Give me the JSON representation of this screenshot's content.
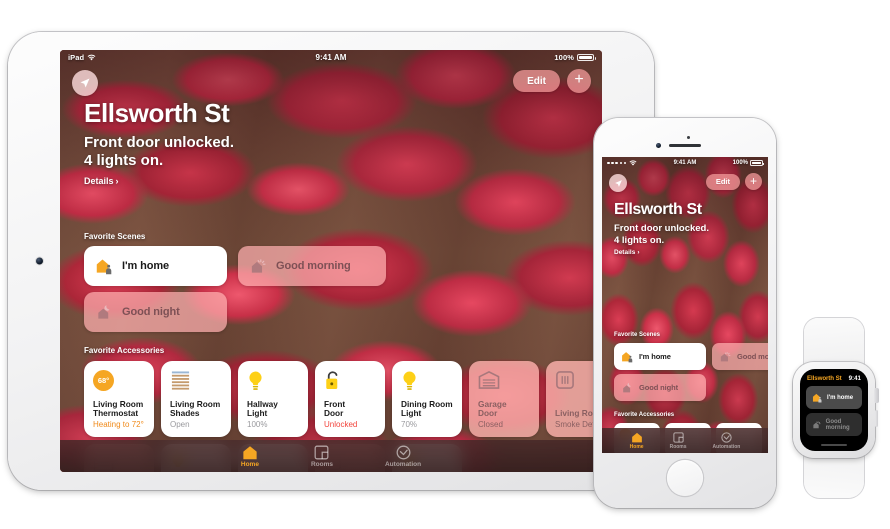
{
  "ipad": {
    "status": {
      "carrier": "iPad",
      "wifi_icon": "wifi-icon",
      "time": "9:41 AM",
      "battery": "100%"
    },
    "header": {
      "location_icon": "location-arrow-icon",
      "edit_label": "Edit",
      "add_label": "+",
      "title": "Ellsworth St",
      "subtitle_line1": "Front door unlocked.",
      "subtitle_line2": "4 lights on.",
      "details_label": "Details",
      "details_chevron": "›"
    },
    "scenes_section_label": "Favorite Scenes",
    "scenes": [
      {
        "label": "I'm home",
        "icon": "home-person-icon",
        "state": "active"
      },
      {
        "label": "Good morning",
        "icon": "home-sun-icon",
        "state": "dim"
      },
      {
        "label": "Good night",
        "icon": "home-moon-icon",
        "state": "dim"
      }
    ],
    "accessories_section_label": "Favorite Accessories",
    "accessories": [
      {
        "name": "Living Room\nThermostat",
        "status": "Heating to 72°",
        "icon": "thermostat-icon",
        "badge": "68°",
        "state": "on",
        "status_style": "warm"
      },
      {
        "name": "Living Room\nShades",
        "status": "Open",
        "icon": "blinds-icon",
        "state": "on",
        "status_style": "muted"
      },
      {
        "name": "Hallway\nLight",
        "status": "100%",
        "icon": "bulb-icon",
        "state": "on",
        "status_style": "muted"
      },
      {
        "name": "Front\nDoor",
        "status": "Unlocked",
        "icon": "unlocked-padlock-icon",
        "state": "on",
        "status_style": "alert"
      },
      {
        "name": "Dining Room\nLight",
        "status": "70%",
        "icon": "bulb-icon",
        "state": "on",
        "status_style": "muted"
      },
      {
        "name": "Garage\nDoor",
        "status": "Closed",
        "icon": "garage-door-icon",
        "state": "off",
        "status_style": "muted"
      },
      {
        "name": "Living Roo",
        "status": "Smoke Det",
        "icon": "smoke-detector-icon",
        "state": "off",
        "status_style": "muted"
      }
    ],
    "tabs": [
      {
        "label": "Home",
        "icon": "home-icon",
        "selected": true
      },
      {
        "label": "Rooms",
        "icon": "rooms-icon",
        "selected": false
      },
      {
        "label": "Automation",
        "icon": "automation-icon",
        "selected": false
      }
    ]
  },
  "iphone": {
    "status": {
      "signal_icon": "signal-dots-icon",
      "wifi_icon": "wifi-icon",
      "time": "9:41 AM",
      "battery": "100%"
    },
    "header": {
      "location_icon": "location-arrow-icon",
      "edit_label": "Edit",
      "add_label": "+",
      "title": "Ellsworth St",
      "subtitle_line1": "Front door unlocked.",
      "subtitle_line2": "4 lights on.",
      "details_label": "Details",
      "details_chevron": "›"
    },
    "scenes_section_label": "Favorite Scenes",
    "scenes": [
      {
        "label": "I'm home",
        "icon": "home-person-icon",
        "state": "active"
      },
      {
        "label": "Good mo",
        "icon": "home-sun-icon",
        "state": "dim"
      },
      {
        "label": "Good night",
        "icon": "home-moon-icon",
        "state": "dim"
      }
    ],
    "accessories_section_label": "Favorite Accessories",
    "tabs": [
      {
        "label": "Home",
        "icon": "home-icon",
        "selected": true
      },
      {
        "label": "Rooms",
        "icon": "rooms-icon",
        "selected": false
      },
      {
        "label": "Automation",
        "icon": "automation-icon",
        "selected": false
      }
    ]
  },
  "watch": {
    "title": "Ellsworth St",
    "time": "9:41",
    "scenes": [
      {
        "label": "I'm home",
        "icon": "home-person-icon",
        "state": "active"
      },
      {
        "label": "Good morning",
        "icon": "home-sun-icon",
        "state": "dim"
      }
    ]
  },
  "colors": {
    "accent_orange": "#f5a623",
    "alert_red": "#f2453d",
    "pill_pink": "rgba(238,150,150,.78)",
    "tile_off_pink": "rgba(255,180,175,.80)"
  }
}
